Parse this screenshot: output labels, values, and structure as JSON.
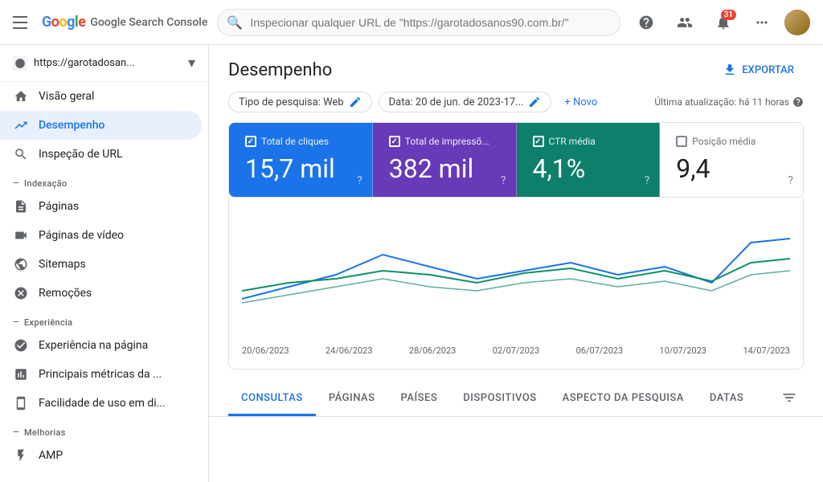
{
  "topbar": {
    "app_title": "Google Search Console",
    "search_placeholder": "Inspecionar qualquer URL de \"https://garotadosanos90.com.br/\"",
    "notification_count": "31",
    "help_icon": "?",
    "user_management_icon": "👤",
    "notification_icon": "🔔",
    "apps_icon": "⋮⋮⋮",
    "google_logo": "Google"
  },
  "sidebar": {
    "site_url": "https://garotadosan...",
    "items": [
      {
        "id": "visao-geral",
        "label": "Visão geral",
        "icon": "🏠"
      },
      {
        "id": "desempenho",
        "label": "Desempenho",
        "icon": "↗",
        "active": true
      },
      {
        "id": "inspecao-url",
        "label": "Inspeção de URL",
        "icon": "🔍"
      }
    ],
    "section_indexacao": "Indexação",
    "indexacao_items": [
      {
        "id": "paginas",
        "label": "Páginas",
        "icon": "📄"
      },
      {
        "id": "paginas-video",
        "label": "Páginas de vídeo",
        "icon": "🎬"
      },
      {
        "id": "sitemaps",
        "label": "Sitemaps",
        "icon": "⚙"
      },
      {
        "id": "remocoes",
        "label": "Remoções",
        "icon": "🚫"
      }
    ],
    "section_experiencia": "Experiência",
    "experiencia_items": [
      {
        "id": "exp-pagina",
        "label": "Experiência na página",
        "icon": "⊕"
      },
      {
        "id": "metricas",
        "label": "Principais métricas da ...",
        "icon": "📊"
      },
      {
        "id": "usabilidade",
        "label": "Facilidade de uso em di...",
        "icon": "📱"
      }
    ],
    "section_melhorias": "Melhorias",
    "melhorias_items": [
      {
        "id": "amp",
        "label": "AMP",
        "icon": "⚡"
      }
    ]
  },
  "content": {
    "title": "Desempenho",
    "export_label": "EXPORTAR",
    "filters": {
      "search_type_label": "Tipo de pesquisa: Web",
      "date_label": "Data: 20 de jun. de 2023-17...",
      "new_label": "+ Novo"
    },
    "last_update": "Última atualização: há 11 horas",
    "metrics": {
      "clicks": {
        "label": "Total de cliques",
        "value": "15,7 mil",
        "checked": true
      },
      "impressions": {
        "label": "Total de impressõ...",
        "value": "382 mil",
        "checked": true
      },
      "ctr": {
        "label": "CTR média",
        "value": "4,1%",
        "checked": true
      },
      "position": {
        "label": "Posição média",
        "value": "9,4",
        "checked": false
      }
    },
    "chart": {
      "dates": [
        "20/06/2023",
        "24/06/2023",
        "28/06/2023",
        "02/07/2023",
        "06/07/2023",
        "10/07/2023",
        "14/07/2023"
      ]
    },
    "tabs": [
      {
        "id": "consultas",
        "label": "CONSULTAS",
        "active": true
      },
      {
        "id": "paginas",
        "label": "PÁGINAS",
        "active": false
      },
      {
        "id": "paises",
        "label": "PAÍSES",
        "active": false
      },
      {
        "id": "dispositivos",
        "label": "DISPOSITIVOS",
        "active": false
      },
      {
        "id": "aspecto",
        "label": "ASPECTO DA PESQUISA",
        "active": false
      },
      {
        "id": "datas",
        "label": "DATAS",
        "active": false
      }
    ]
  }
}
